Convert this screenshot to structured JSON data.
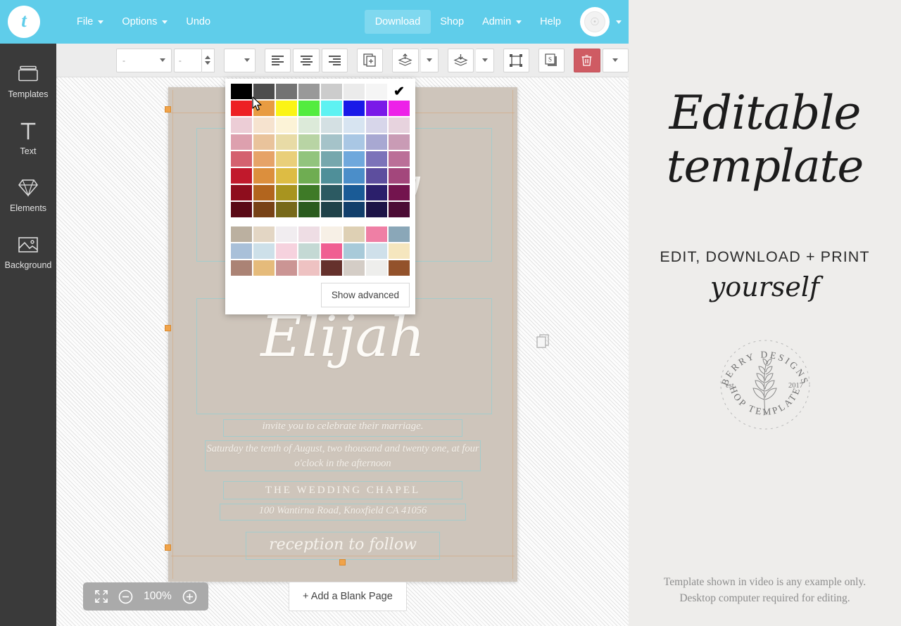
{
  "app": {
    "logo_letter": "t",
    "accent_color": "#5fcdea",
    "canvas_color": "#cec5bb"
  },
  "topnav": {
    "left_items": [
      {
        "label": "File",
        "has_caret": true
      },
      {
        "label": "Options",
        "has_caret": true
      },
      {
        "label": "Undo",
        "has_caret": false
      }
    ],
    "right_items": [
      {
        "label": "Download",
        "has_caret": false,
        "highlighted": true
      },
      {
        "label": "Shop",
        "has_caret": false,
        "highlighted": false
      },
      {
        "label": "Admin",
        "has_caret": true,
        "highlighted": false
      },
      {
        "label": "Help",
        "has_caret": false,
        "highlighted": false
      }
    ],
    "avatar_name": "user-avatar"
  },
  "sidebar": {
    "items": [
      {
        "label": "Templates",
        "icon": "templates-folder-icon"
      },
      {
        "label": "Text",
        "icon": "text-t-icon"
      },
      {
        "label": "Elements",
        "icon": "elements-diamond-icon"
      },
      {
        "label": "Background",
        "icon": "background-image-icon"
      }
    ]
  },
  "toolbar": {
    "font_value": "-",
    "size_value": "-",
    "style_value": "",
    "buttons": [
      {
        "name": "align-left-button",
        "icon": "align-left-icon"
      },
      {
        "name": "align-center-button",
        "icon": "align-center-icon"
      },
      {
        "name": "align-right-button",
        "icon": "align-right-icon"
      },
      {
        "name": "duplicate-button",
        "icon": "duplicate-icon"
      },
      {
        "name": "bring-forward-button",
        "icon": "bring-forward-icon"
      },
      {
        "name": "send-backward-button",
        "icon": "send-backward-icon"
      },
      {
        "name": "group-button",
        "icon": "group-icon"
      },
      {
        "name": "shadow-button",
        "icon": "shadow-s-icon"
      },
      {
        "name": "delete-button",
        "icon": "trash-icon"
      },
      {
        "name": "more-options-button",
        "icon": "chevron-down-icon"
      }
    ]
  },
  "color_picker": {
    "rows": [
      [
        "#000000",
        "#4d4d4d",
        "#737373",
        "#999999",
        "#cccccc",
        "#ebebeb",
        "#f5f5f5"
      ],
      [
        "#ed2024",
        "#e89c42",
        "#fbf415",
        "#53ec3f",
        "#5ef2f2",
        "#1919e8",
        "#7a19e8",
        "#ed22e8"
      ],
      [
        "#eccdd6",
        "#f6e3cf",
        "#fcf3d7",
        "#dcead9",
        "#d4e0e3",
        "#d7e4f1",
        "#d7d6ea",
        "#e7d3de"
      ],
      [
        "#dda0ae",
        "#e9c39b",
        "#e8dba6",
        "#b8d4a4",
        "#a5c3c9",
        "#a9c7e4",
        "#a8a8d2",
        "#c99bb5"
      ],
      [
        "#d4616f",
        "#e6a368",
        "#e9cf7a",
        "#92c47d",
        "#76a7ad",
        "#6fa8dc",
        "#7c73b9",
        "#bb6f98"
      ],
      [
        "#c1192c",
        "#dc8f3d",
        "#ddbc44",
        "#6fad52",
        "#4f8f99",
        "#4b8ec9",
        "#5d4e9e",
        "#a3477c"
      ],
      [
        "#8e0d1d",
        "#b2651e",
        "#a8941f",
        "#3e7a27",
        "#2c5a62",
        "#1a5b96",
        "#2b1f6b",
        "#73144e"
      ],
      [
        "#5a0a16",
        "#784216",
        "#77691a",
        "#2a5b1e",
        "#204249",
        "#123f6b",
        "#1d1447",
        "#4c0c35"
      ]
    ],
    "custom_rows": [
      [
        "#bbb0a0",
        "#e3d6c4",
        "#f1edf0",
        "#eedde4",
        "#f7f0e6",
        "#ded0b4",
        "#ef7fa5",
        "#8aa7b8"
      ],
      [
        "#a9c0d9",
        "#cde0e9",
        "#f6d2de",
        "#c4d9d4",
        "#f05f92",
        "#a8cad9",
        "#cfe0ea",
        "#f5e6be"
      ],
      [
        "#ab8375",
        "#e5bb7b",
        "#cb9594",
        "#eec2c2",
        "#65312c",
        "#d4cdc6",
        "#eeeeec",
        "#93522b"
      ]
    ],
    "selected_swatch": "check",
    "advanced_label": "Show advanced"
  },
  "canvas": {
    "text_blocks": [
      {
        "name": "bride-name",
        "text": "Avery"
      },
      {
        "name": "groom-name",
        "text": "Elijah"
      },
      {
        "name": "invite-line",
        "text": "invite you to celebrate their marriage."
      },
      {
        "name": "date-line",
        "text": "Saturday the tenth of August, two thousand and twenty one, at four o'clock in the afternoon"
      },
      {
        "name": "venue-name",
        "text": "THE WEDDING CHAPEL"
      },
      {
        "name": "venue-address",
        "text": "100 Wantirna Road, Knoxfield CA 41056"
      },
      {
        "name": "reception-line",
        "text": "reception to follow"
      }
    ]
  },
  "bottom": {
    "zoom_level": "100%",
    "add_page_label": "+ Add a Blank Page",
    "fit_icon": "fit-screen-icon",
    "zoom_out_icon": "minus-circle-icon",
    "zoom_in_icon": "plus-circle-icon"
  },
  "promo": {
    "headline_line1": "Editable",
    "headline_line2": "template",
    "subhead": "EDIT, DOWNLOAD + PRINT",
    "subhead_script": "yourself",
    "badge": {
      "top_text": "BERRY DESIGNS",
      "bottom_text": "SHOP TEMPLATES",
      "left_text": "est",
      "right_text": "2017"
    },
    "footer_line1": "Template shown in video is any example only.",
    "footer_line2": "Desktop computer required for editing."
  }
}
